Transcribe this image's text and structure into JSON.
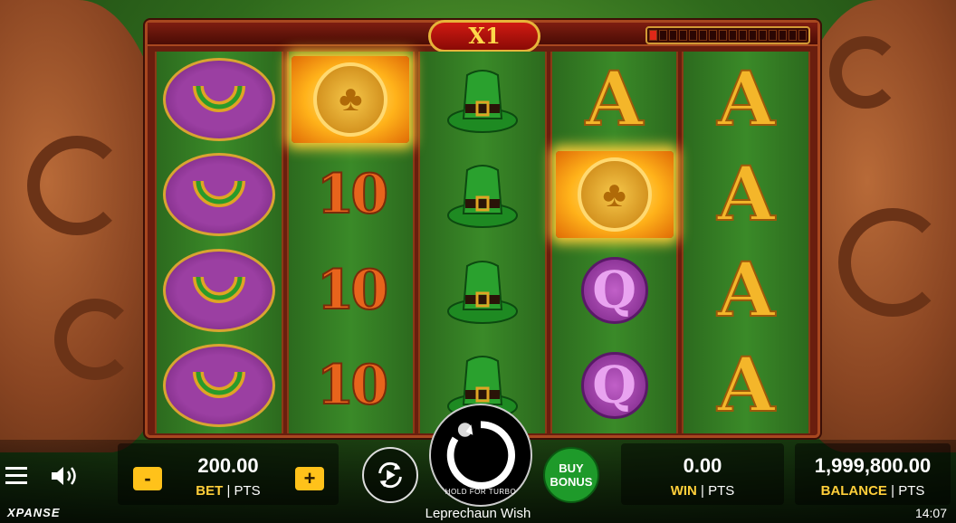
{
  "game": {
    "title": "Leprechaun Wish",
    "multiplier": "X1",
    "meter_segments_total": 16,
    "meter_segments_filled": 1
  },
  "reels": [
    [
      "horseshoe",
      "horseshoe",
      "horseshoe",
      "horseshoe"
    ],
    [
      "gold-coin",
      "10",
      "10",
      "10"
    ],
    [
      "hat",
      "hat",
      "hat",
      "hat"
    ],
    [
      "A",
      "gold-coin",
      "Q",
      "Q"
    ],
    [
      "A",
      "A",
      "A",
      "A"
    ]
  ],
  "hud": {
    "bet_value": "200.00",
    "bet_label": "BET",
    "bet_unit": "| PTS",
    "decrease_label": "-",
    "increase_label": "+",
    "spin_hint": "HOLD FOR TURBO",
    "buy_bonus_line1": "BUY",
    "buy_bonus_line2": "BONUS",
    "win_value": "0.00",
    "win_label": "WIN",
    "win_unit": "| PTS",
    "balance_value": "1,999,800.00",
    "balance_label": "BALANCE",
    "balance_unit": "| PTS",
    "clock": "14:07",
    "brand": "XPANSE"
  },
  "colors": {
    "accent_gold": "#ffcf3a",
    "buy_bonus_green": "#1e9a2a",
    "frame_red": "#6a1e0e"
  }
}
